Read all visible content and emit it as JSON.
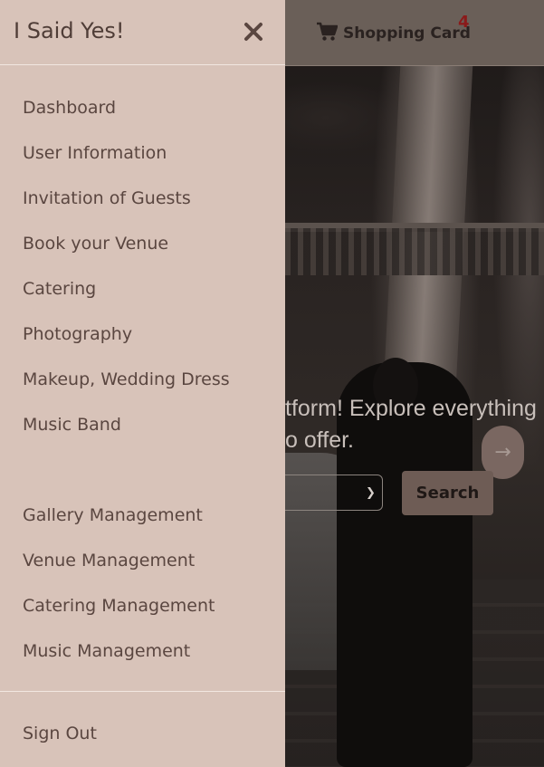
{
  "app": {
    "brand": "I Said Yes!",
    "close_icon": "close-icon"
  },
  "topbar": {
    "cart_label": "Shopping Card",
    "cart_count": "4",
    "cart_icon": "shopping-cart-icon"
  },
  "hero": {
    "text_line1": "tform! Explore everything",
    "text_line2": "o offer.",
    "search_label": "Search",
    "arrow_label": "→"
  },
  "menu": {
    "items": [
      {
        "label": "Dashboard"
      },
      {
        "label": "User Information"
      },
      {
        "label": "Invitation of Guests"
      },
      {
        "label": "Book your Venue"
      },
      {
        "label": "Catering"
      },
      {
        "label": "Photography"
      },
      {
        "label": "Makeup, Wedding Dress"
      },
      {
        "label": "Music Band"
      }
    ],
    "management_items": [
      {
        "label": "Gallery Management"
      },
      {
        "label": "Venue Management"
      },
      {
        "label": "Catering Management"
      },
      {
        "label": "Music Management"
      }
    ],
    "sign_out": "Sign Out"
  },
  "colors": {
    "drawer_bg": "#d8c3b9",
    "drawer_text": "#5a4640",
    "cart_badge": "#8b1a1a",
    "search_button": "#6e5c55"
  }
}
